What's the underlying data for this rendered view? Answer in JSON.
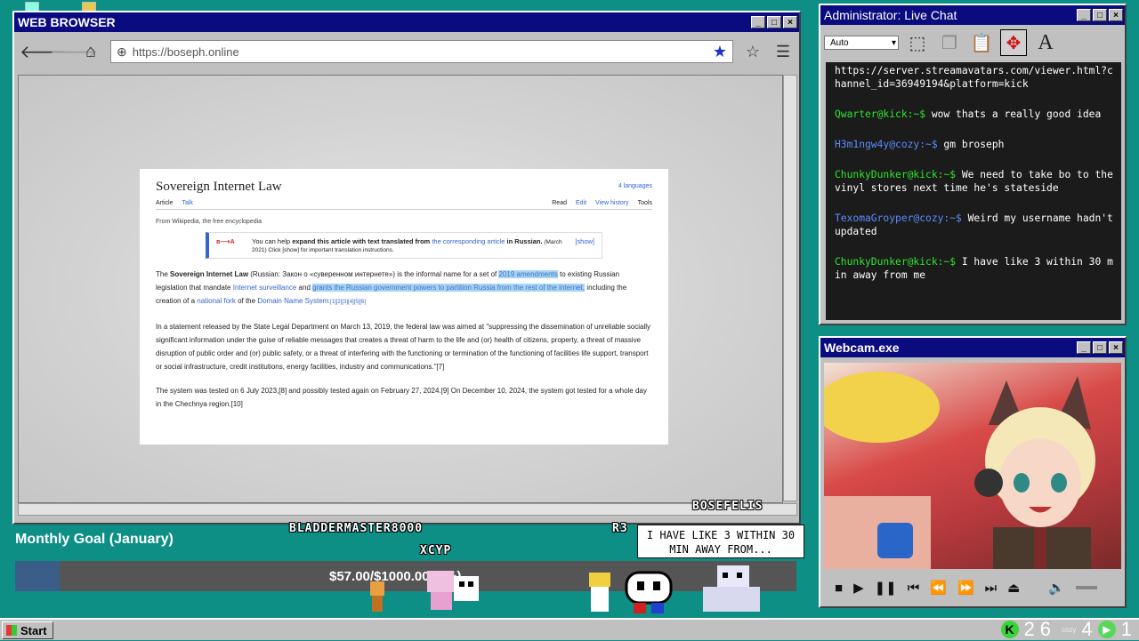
{
  "browser": {
    "title": "WEB BROWSER",
    "url": "https://boseph.online",
    "nav": {
      "back": "back-icon",
      "forward": "forward-icon",
      "home": "home-icon"
    }
  },
  "wiki": {
    "title": "Sovereign Internet Law",
    "languages": "4 languages",
    "tab_article": "Article",
    "tab_talk": "Talk",
    "tab_read": "Read",
    "tab_edit": "Edit",
    "tab_history": "View history",
    "tab_tools": "Tools",
    "from": "From Wikipedia, the free encyclopedia",
    "notice_symbol": "ʙ⟶A",
    "notice_pre": "You can help ",
    "notice_bold": "expand this article with text translated from ",
    "notice_link": "the corresponding article",
    "notice_in": " in Russian.",
    "notice_small": " (March 2021) Click [show] for important translation instructions.",
    "notice_show": "[show]",
    "p1_a": "The ",
    "p1_b": "Sovereign Internet Law",
    "p1_c": " (Russian: Закон о «суверенном интернете») is the informal name for a set of ",
    "p1_d": "2019 amendments",
    "p1_e": " to existing Russian legislation that mandate ",
    "p1_f": "Internet surveillance",
    "p1_g": " and ",
    "p1_h": "grants the Russian government powers to partition Russia from the rest of the internet,",
    "p1_i": " including the creation of a ",
    "p1_j": "national fork",
    "p1_k": " of the ",
    "p1_l": "Domain Name System",
    "p1_m": ".[1][2][3][4][5][6]",
    "p2": "In a statement released by the State Legal Department on March 13, 2019, the federal law was aimed at \"suppressing the dissemination of unreliable socially significant information under the guise of reliable messages that creates a threat of harm to the life and (or) health of citizens, property, a threat of massive disruption of public order and (or) public safety, or a threat of interfering with the functioning or termination of the functioning of facilities life support, transport or social infrastructure, credit institutions, energy facilities, industry and communications.\"[7]",
    "p3": "The system was tested on 6 July 2023,[8] and possibly tested again on February 27, 2024.[9] On December 10, 2024, the system got tested for a whole day in the Chechnya region.[10]"
  },
  "chat": {
    "title": "Administrator: Live Chat",
    "font_size": "Auto",
    "messages": [
      {
        "user": "",
        "text": "https://server.streamavatars.com/viewer.html?channel_id=36949194&platform=kick",
        "color": "#ffffff"
      },
      {
        "user": "Qwarter@kick:~$",
        "text": " wow thats a really good idea",
        "color": "#2de52d"
      },
      {
        "user": "H3m1ngw4y@cozy:~$",
        "text": " gm broseph",
        "color": "#5a8cff"
      },
      {
        "user": "ChunkyDunker@kick:~$",
        "text": " We need to take bo to the vinyl stores next time he's stateside",
        "color": "#2de52d"
      },
      {
        "user": "TexomaGroyper@cozy:~$",
        "text": " Weird my username hadn't updated",
        "color": "#5a8cff"
      },
      {
        "user": "ChunkyDunker@kick:~$",
        "text": " I have like 3 within 30 min away from me",
        "color": "#2de52d"
      }
    ]
  },
  "webcam": {
    "title": "Webcam.exe"
  },
  "overlay": {
    "goal_label": "Monthly Goal (January)",
    "goal_text": "$57.00/$1000.00 (6%)",
    "goal_fraction": 0.057,
    "name_bosefelis": "BOSEFELIS",
    "name_bladder": "BLADDERMASTER8000",
    "name_xcyp": "XCYP",
    "name_r3": "R3",
    "bubble": "I HAVE LIKE 3 WITHIN 30 MIN AWAY FROM..."
  },
  "taskbar": {
    "start": "Start",
    "kick_count": "26",
    "cozy_count": "4",
    "cozy_label": "cozy",
    "other_count": "1"
  }
}
